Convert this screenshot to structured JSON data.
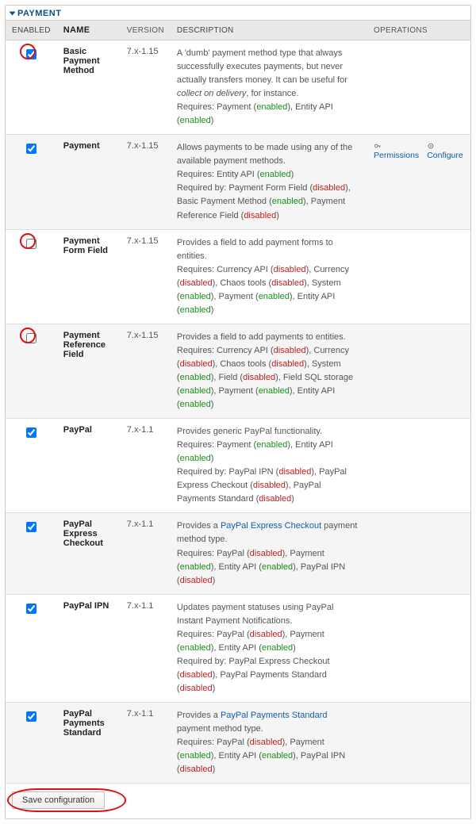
{
  "panel_title": "PAYMENT",
  "columns": {
    "enabled": "ENABLED",
    "name": "NAME",
    "version": "VERSION",
    "description": "DESCRIPTION",
    "operations": "OPERATIONS"
  },
  "status": {
    "enabled": "enabled",
    "disabled": "disabled"
  },
  "labels": {
    "requires": "Requires:",
    "required_by": "Required by:",
    "permissions": "Permissions",
    "configure": "Configure",
    "save": "Save configuration"
  },
  "rows": [
    {
      "checked": true,
      "ring": true,
      "name": "Basic Payment Method",
      "version": "7.x-1.15",
      "desc_pre": "A 'dumb' payment method type that always successfully executes payments, but never actually transfers money. It can be useful for ",
      "desc_em": "collect on delivery",
      "desc_post": ", for instance.",
      "requires": [
        {
          "t": "Payment",
          "s": "enabled"
        },
        {
          "t": "Entity API",
          "s": "enabled"
        }
      ]
    },
    {
      "checked": true,
      "name": "Payment",
      "version": "7.x-1.15",
      "desc_pre": "Allows payments to be made using any of the available payment methods.",
      "requires": [
        {
          "t": "Entity API",
          "s": "enabled"
        }
      ],
      "required_by": [
        {
          "t": "Payment Form Field",
          "s": "disabled"
        },
        {
          "t": "Basic Payment Method",
          "s": "enabled"
        },
        {
          "t": "Payment Reference Field",
          "s": "disabled"
        }
      ],
      "ops": true
    },
    {
      "checked": false,
      "ring": true,
      "name": "Payment Form Field",
      "version": "7.x-1.15",
      "desc_pre": "Provides a field to add payment forms to entities.",
      "requires": [
        {
          "t": "Currency API",
          "s": "disabled"
        },
        {
          "t": "Currency",
          "s": "disabled"
        },
        {
          "t": "Chaos tools",
          "s": "disabled"
        },
        {
          "t": "System",
          "s": "enabled"
        },
        {
          "t": "Payment",
          "s": "enabled"
        },
        {
          "t": "Entity API",
          "s": "enabled"
        }
      ]
    },
    {
      "checked": false,
      "ring": true,
      "name": "Payment Reference Field",
      "version": "7.x-1.15",
      "desc_pre": "Provides a field to add payments to entities.",
      "requires": [
        {
          "t": "Currency API",
          "s": "disabled"
        },
        {
          "t": "Currency",
          "s": "disabled"
        },
        {
          "t": "Chaos tools",
          "s": "disabled"
        },
        {
          "t": "System",
          "s": "enabled"
        },
        {
          "t": "Field",
          "s": "disabled"
        },
        {
          "t": "Field SQL storage",
          "s": "enabled"
        },
        {
          "t": "Payment",
          "s": "enabled"
        },
        {
          "t": "Entity API",
          "s": "enabled"
        }
      ]
    },
    {
      "checked": true,
      "name": "PayPal",
      "version": "7.x-1.1",
      "desc_pre": "Provides generic PayPal functionality.",
      "requires": [
        {
          "t": "Payment",
          "s": "enabled"
        },
        {
          "t": "Entity API",
          "s": "enabled"
        }
      ],
      "required_by": [
        {
          "t": "PayPal IPN",
          "s": "disabled"
        },
        {
          "t": "PayPal Express Checkout",
          "s": "disabled"
        },
        {
          "t": "PayPal Payments Standard",
          "s": "disabled"
        }
      ]
    },
    {
      "checked": true,
      "name": "PayPal Express Checkout",
      "version": "7.x-1.1",
      "desc_pre": "Provides a ",
      "desc_link": "PayPal Express Checkout",
      "desc_post": " payment method type.",
      "requires": [
        {
          "t": "PayPal",
          "s": "disabled"
        },
        {
          "t": "Payment",
          "s": "enabled"
        },
        {
          "t": "Entity API",
          "s": "enabled"
        },
        {
          "t": "PayPal IPN",
          "s": "disabled"
        }
      ]
    },
    {
      "checked": true,
      "name": "PayPal IPN",
      "version": "7.x-1.1",
      "desc_pre": "Updates payment statuses using PayPal Instant Payment Notifications.",
      "requires": [
        {
          "t": "PayPal",
          "s": "disabled"
        },
        {
          "t": "Payment",
          "s": "enabled"
        },
        {
          "t": "Entity API",
          "s": "enabled"
        }
      ],
      "required_by": [
        {
          "t": "PayPal Express Checkout",
          "s": "disabled"
        },
        {
          "t": "PayPal Payments Standard",
          "s": "disabled"
        }
      ]
    },
    {
      "checked": true,
      "name": "PayPal Payments Standard",
      "version": "7.x-1.1",
      "desc_pre": "Provides a ",
      "desc_link": "PayPal Payments Standard",
      "desc_post": " payment method type.",
      "requires": [
        {
          "t": "PayPal",
          "s": "disabled"
        },
        {
          "t": "Payment",
          "s": "enabled"
        },
        {
          "t": "Entity API",
          "s": "enabled"
        },
        {
          "t": "PayPal IPN",
          "s": "disabled"
        }
      ]
    }
  ]
}
